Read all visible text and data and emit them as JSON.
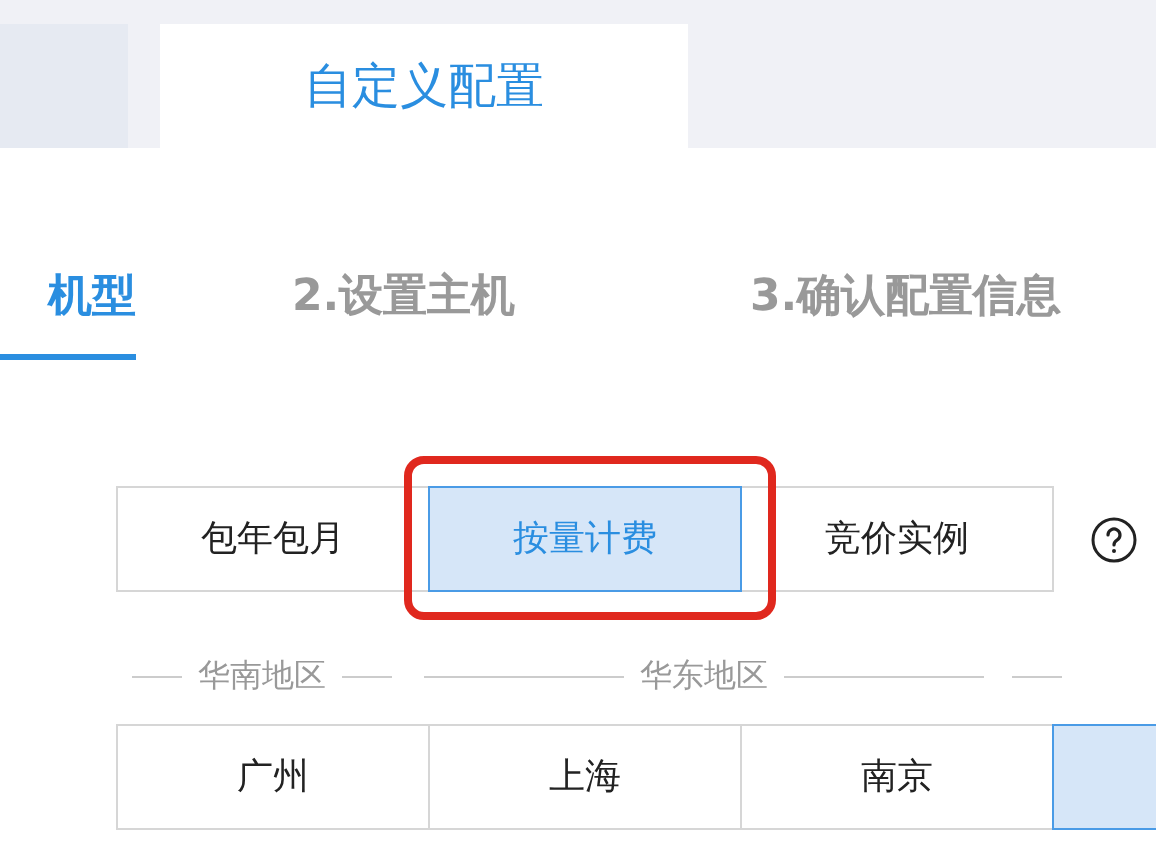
{
  "mode_tabs": [
    {
      "selected": false
    },
    {
      "label": "自定义配置",
      "selected": true
    }
  ],
  "steps": [
    {
      "label": "机型",
      "selected": true
    },
    {
      "label": "2.设置主机",
      "selected": false
    },
    {
      "label": "3.确认配置信息",
      "selected": false
    }
  ],
  "billing": [
    {
      "label": "包年包月",
      "selected": false
    },
    {
      "label": "按量计费",
      "selected": true,
      "highlighted": true
    },
    {
      "label": "竞价实例",
      "selected": false
    }
  ],
  "region_groups": [
    {
      "label": "华南地区"
    },
    {
      "label": "华东地区"
    }
  ],
  "cities": [
    {
      "label": "广州",
      "selected": false
    },
    {
      "label": "上海",
      "selected": false
    },
    {
      "label": "南京",
      "selected": false
    },
    {
      "selected": true
    }
  ]
}
